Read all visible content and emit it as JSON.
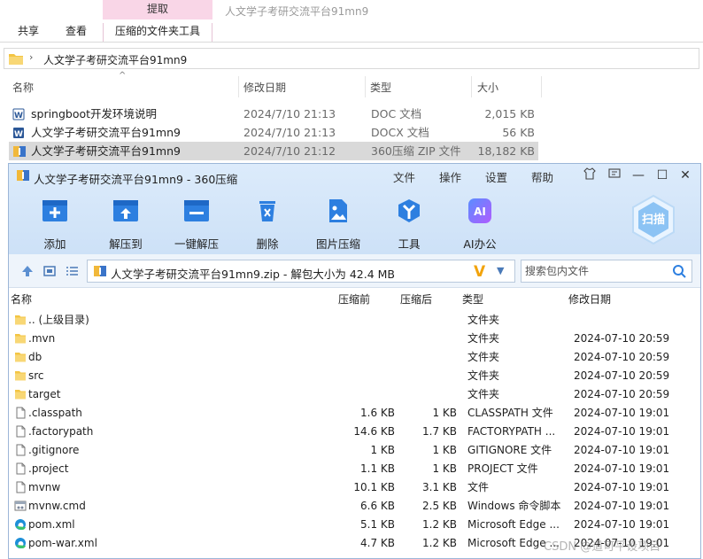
{
  "explorer": {
    "window_title": "人文学子考研交流平台91mn9",
    "ribbon": {
      "context_header": "提取",
      "tabs": [
        "共享",
        "查看",
        "压缩的文件夹工具"
      ]
    },
    "address": {
      "path": "人文学子考研交流平台91mn9"
    },
    "columns": {
      "name": "名称",
      "date": "修改日期",
      "type": "类型",
      "size": "大小"
    },
    "files": [
      {
        "name": "springboot开发环境说明",
        "date": "2024/7/10 21:13",
        "type": "DOC 文档",
        "size": "2,015 KB",
        "icon": "word-doc-icon"
      },
      {
        "name": "人文学子考研交流平台91mn9",
        "date": "2024/7/10 21:13",
        "type": "DOCX 文档",
        "size": "56 KB",
        "icon": "word-docx-icon"
      },
      {
        "name": "人文学子考研交流平台91mn9",
        "date": "2024/7/10 21:12",
        "type": "360压缩 ZIP 文件",
        "size": "18,182 KB",
        "icon": "zip-archive-icon",
        "selected": true
      }
    ]
  },
  "zip_window": {
    "title": "人文学子考研交流平台91mn9 - 360压缩",
    "menu": [
      "文件",
      "操作",
      "设置",
      "帮助"
    ],
    "toolbar": [
      {
        "label": "添加",
        "icon": "add-icon"
      },
      {
        "label": "解压到",
        "icon": "extract-to-icon"
      },
      {
        "label": "一键解压",
        "icon": "one-click-extract-icon"
      },
      {
        "label": "删除",
        "icon": "delete-icon"
      },
      {
        "label": "图片压缩",
        "icon": "image-compress-icon"
      },
      {
        "label": "工具",
        "icon": "tools-icon"
      },
      {
        "label": "AI办公",
        "icon": "ai-office-icon"
      }
    ],
    "scan_label": "扫描",
    "ai_badge": "AI",
    "path_text": "人文学子考研交流平台91mn9.zip - 解包大小为 42.4 MB",
    "search_placeholder": "搜索包内文件",
    "columns": {
      "name": "名称",
      "compressed": "压缩前",
      "packed": "压缩后",
      "type": "类型",
      "modified": "修改日期"
    },
    "rows": [
      {
        "name": ".. (上级目录)",
        "compressed": "",
        "packed": "",
        "type": "文件夹",
        "modified": "",
        "icon": "folder-icon"
      },
      {
        "name": ".mvn",
        "compressed": "",
        "packed": "",
        "type": "文件夹",
        "modified": "2024-07-10 20:59",
        "icon": "folder-icon"
      },
      {
        "name": "db",
        "compressed": "",
        "packed": "",
        "type": "文件夹",
        "modified": "2024-07-10 20:59",
        "icon": "folder-icon"
      },
      {
        "name": "src",
        "compressed": "",
        "packed": "",
        "type": "文件夹",
        "modified": "2024-07-10 20:59",
        "icon": "folder-icon"
      },
      {
        "name": "target",
        "compressed": "",
        "packed": "",
        "type": "文件夹",
        "modified": "2024-07-10 20:59",
        "icon": "folder-icon"
      },
      {
        "name": ".classpath",
        "compressed": "1.6 KB",
        "packed": "1 KB",
        "type": "CLASSPATH 文件",
        "modified": "2024-07-10 19:01",
        "icon": "file-icon"
      },
      {
        "name": ".factorypath",
        "compressed": "14.6 KB",
        "packed": "1.7 KB",
        "type": "FACTORYPATH ...",
        "modified": "2024-07-10 19:01",
        "icon": "file-icon"
      },
      {
        "name": ".gitignore",
        "compressed": "1 KB",
        "packed": "1 KB",
        "type": "GITIGNORE 文件",
        "modified": "2024-07-10 19:01",
        "icon": "file-icon"
      },
      {
        "name": ".project",
        "compressed": "1.1 KB",
        "packed": "1 KB",
        "type": "PROJECT 文件",
        "modified": "2024-07-10 19:01",
        "icon": "file-icon"
      },
      {
        "name": "mvnw",
        "compressed": "10.1 KB",
        "packed": "3.1 KB",
        "type": "文件",
        "modified": "2024-07-10 19:01",
        "icon": "file-icon"
      },
      {
        "name": "mvnw.cmd",
        "compressed": "6.6 KB",
        "packed": "2.5 KB",
        "type": "Windows 命令脚本",
        "modified": "2024-07-10 19:01",
        "icon": "cmd-script-icon"
      },
      {
        "name": "pom.xml",
        "compressed": "5.1 KB",
        "packed": "1.2 KB",
        "type": "Microsoft Edge ...",
        "modified": "2024-07-10 19:01",
        "icon": "edge-icon"
      },
      {
        "name": "pom-war.xml",
        "compressed": "4.7 KB",
        "packed": "1.2 KB",
        "type": "Microsoft Edge ...",
        "modified": "2024-07-10 19:01",
        "icon": "edge-icon"
      }
    ]
  },
  "watermark": "CSDN @道可平设项目"
}
